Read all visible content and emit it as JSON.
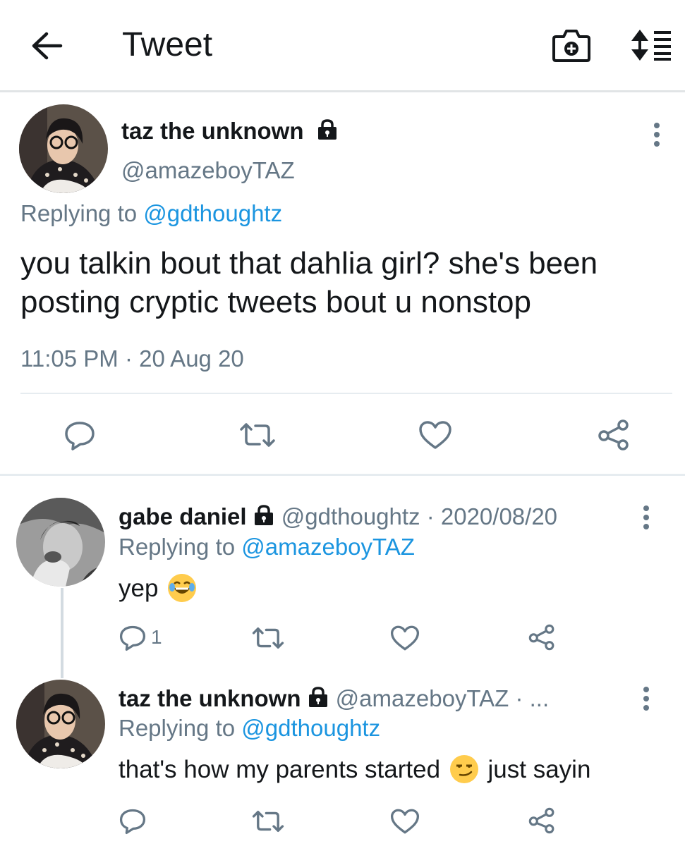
{
  "header": {
    "title": "Tweet",
    "back_icon": "arrow-left-icon",
    "camera_icon": "camera-plus-icon",
    "sort_icon": "sort-icon"
  },
  "main_tweet": {
    "name": "taz the unknown",
    "handle": "@amazeboyTAZ",
    "replying_prefix": "Replying to",
    "replying_to": "@gdthoughtz",
    "text_line1": "you talkin bout that dahlia girl? she's been",
    "text_line2": "posting cryptic tweets bout u nonstop",
    "timestamp": "11:05 PM · 20 Aug 20"
  },
  "replies": [
    {
      "name": "gabe daniel",
      "handle": "@gdthoughtz",
      "date": "· 2020/08/20",
      "replying_prefix": "Replying to",
      "replying_to": "@amazeboyTAZ",
      "text": "yep",
      "emoji": "joy-emoji",
      "reply_count": "1"
    },
    {
      "name": "taz the unknown",
      "handle": "@amazeboyTAZ",
      "date": "· ...",
      "replying_prefix": "Replying to",
      "replying_to": "@gdthoughtz",
      "text_before": "that's how my parents started",
      "emoji": "smirk-emoji",
      "text_after": "just sayin"
    }
  ],
  "colors": {
    "link": "#1b95e0",
    "secondary": "#657786",
    "text": "#14171a",
    "divider": "#e6ecf0"
  }
}
